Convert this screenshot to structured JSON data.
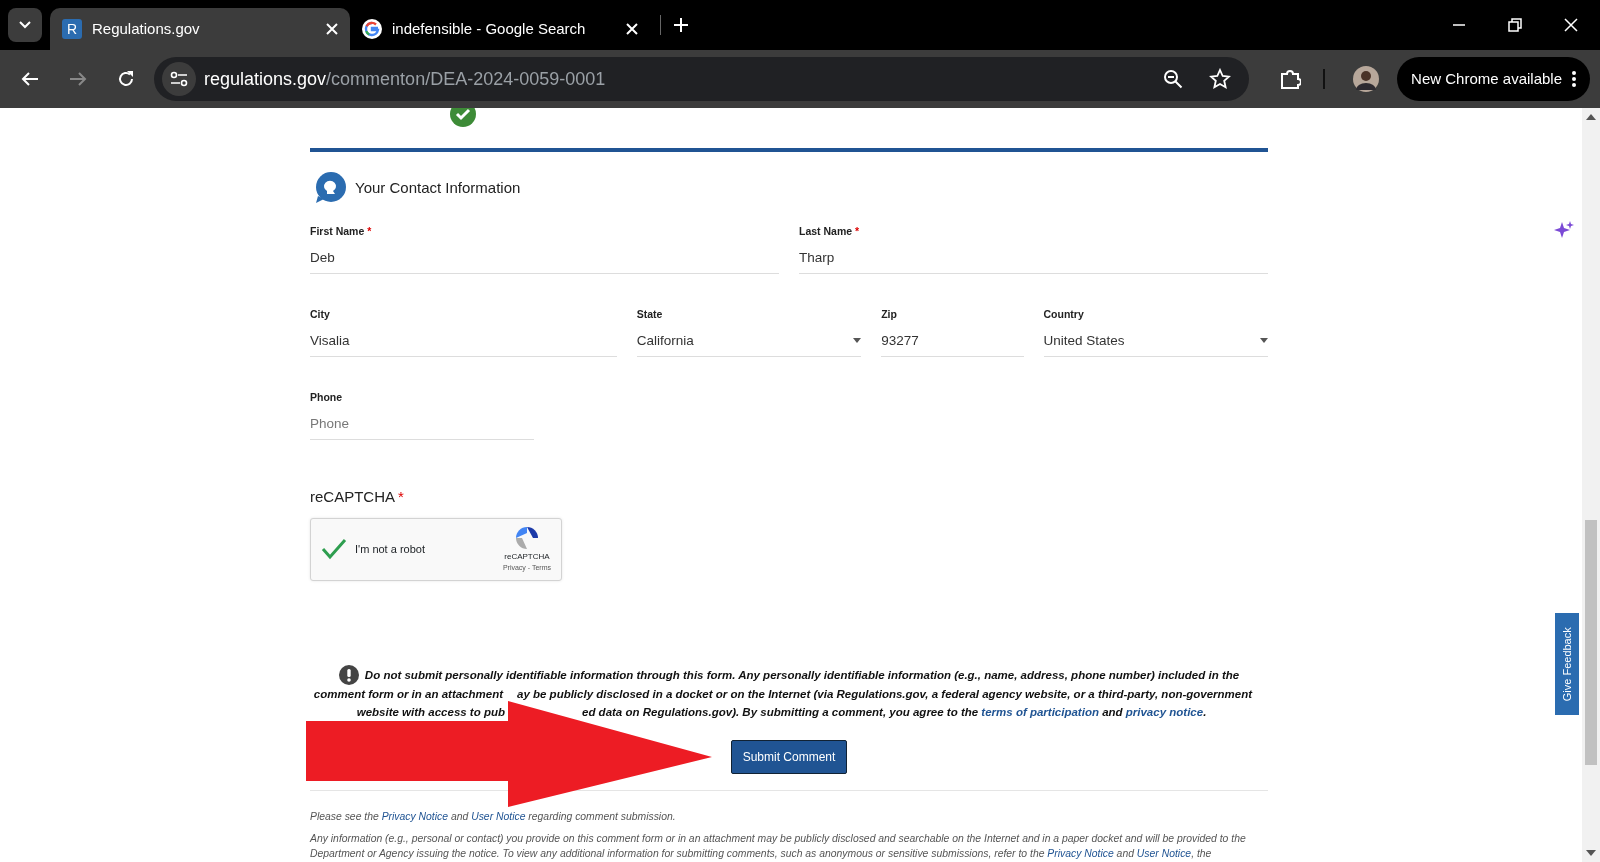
{
  "browser": {
    "tabs": [
      {
        "title": "Regulations.gov",
        "favicon": "R",
        "kind": "site",
        "selected": true
      },
      {
        "title": "indefensible - Google Search",
        "kind": "google",
        "selected": false
      }
    ],
    "url": {
      "host": "regulations.gov",
      "path": "/commenton/DEA-2024-0059-0001"
    },
    "update_button": "New Chrome available"
  },
  "section": {
    "title": "Your Contact Information"
  },
  "field_rows": [
    [
      {
        "label": "First Name",
        "required_mark": "*",
        "kind": "text",
        "value": "Deb"
      },
      {
        "label": "Last Name",
        "required_mark": "*",
        "kind": "text",
        "value": "Tharp"
      }
    ],
    [
      {
        "label": "City",
        "kind": "text",
        "value": "Visalia"
      },
      {
        "label": "State",
        "kind": "select",
        "value": "California"
      },
      {
        "label": "Zip",
        "kind": "text",
        "value": "93277"
      },
      {
        "label": "Country",
        "kind": "select",
        "value": "United States"
      }
    ],
    [
      {
        "label": "Phone",
        "kind": "text",
        "placeholder": "Phone"
      }
    ]
  ],
  "recaptcha": {
    "label": "reCAPTCHA",
    "required_mark": "*",
    "checked": true,
    "text": "I'm not a robot",
    "brand": "reCAPTCHA",
    "links": "Privacy - Terms"
  },
  "warning": [
    [
      {
        "kind": "text",
        "text": "Do not submit personally identifiable information through this form. Any personally identifiable information (e.g., name, address, phone number) included in the"
      }
    ],
    [
      {
        "kind": "text",
        "text": "comment form or in an attachment"
      },
      {
        "kind": "hidden"
      },
      {
        "kind": "text",
        "text": "ay be publicly disclosed in a docket or on the Internet (via Regulations.gov, a federal agency website, or a third-party, non-government"
      }
    ],
    [
      {
        "kind": "text",
        "text": "website with access to pub"
      },
      {
        "kind": "hidden"
      },
      {
        "kind": "text",
        "text": "ed data on Regulations.gov). By submitting a comment, you agree to the "
      },
      {
        "kind": "link",
        "text": "terms of participation"
      },
      {
        "kind": "text",
        "text": " and "
      },
      {
        "kind": "link",
        "text": "privacy notice"
      },
      {
        "kind": "text",
        "text": "."
      }
    ]
  ],
  "submit_button": "Submit Comment",
  "footer": [
    [
      {
        "kind": "text",
        "text": "Please see the "
      },
      {
        "kind": "link",
        "text": "Privacy Notice"
      },
      {
        "kind": "text",
        "text": " and "
      },
      {
        "kind": "link",
        "text": "User Notice"
      },
      {
        "kind": "text",
        "text": " regarding comment submission."
      }
    ],
    [
      {
        "kind": "text",
        "text": "Any information (e.g., personal or contact) you provide on this comment form or in an attachment may be publicly disclosed and searchable on the Internet and in a paper docket and will be provided to the"
      }
    ],
    [
      {
        "kind": "text",
        "text": "Department or Agency issuing the notice. To view any additional information for submitting comments, such as anonymous or sensitive submissions, refer to the "
      },
      {
        "kind": "link",
        "text": "Privacy Notice"
      },
      {
        "kind": "text",
        "text": " and "
      },
      {
        "kind": "link",
        "text": "User Notice"
      },
      {
        "kind": "text",
        "text": ", the"
      }
    ]
  ],
  "feedback_tab": "Give Feedback"
}
